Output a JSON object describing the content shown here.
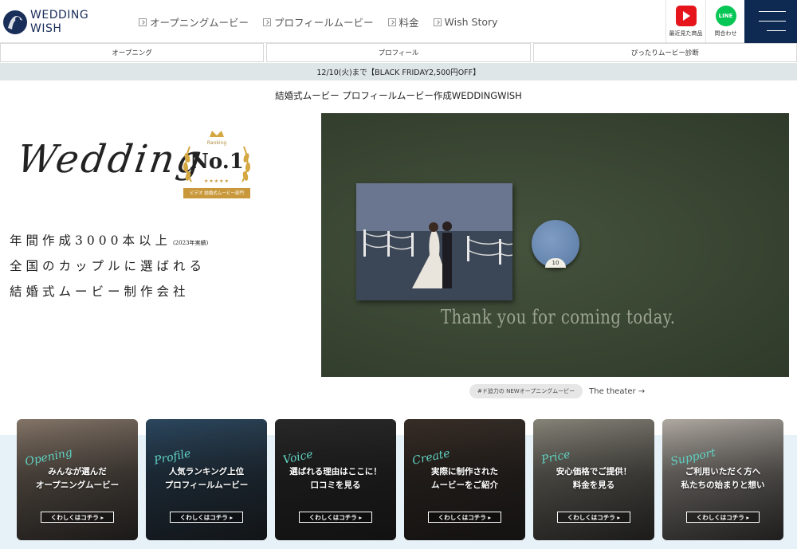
{
  "header": {
    "logo_line1": "WEDDING",
    "logo_line2": "WISH",
    "nav": [
      "オープニングムービー",
      "プロフィールムービー",
      "料金",
      "Wish Story"
    ],
    "recent_label": "最近見た商品",
    "contact_label": "問合わせ",
    "line_icon_text": "LINE"
  },
  "subtabs": [
    "オープニング",
    "プロフィール",
    "ぴったりムービー診断"
  ],
  "promo": "12/10(火)まで【BLACK FRIDAY2,500円OFF】",
  "site_title": "結婚式ムービー プロフィールムービー作成WEDDINGWISH",
  "hero": {
    "script": "Wedding",
    "badge_ranking": "Ranking",
    "badge_no1": "No.1",
    "badge_stars": "★★★★★",
    "badge_ribbon": "ビデオ 結婚式ムービー部門",
    "line1": "年間作成3000本以上",
    "line1_note": "(2023年実績)",
    "line2": "全国のカップルに選ばれる",
    "line3": "結婚式ムービー制作会社"
  },
  "video": {
    "overlay_text": "Thank you for coming today.",
    "disc_number": "10",
    "caption_tag": "#ド迫力の NEWオープニングムービー",
    "caption_link": "The theater →"
  },
  "cards": [
    {
      "script": "Opening",
      "title": "みんなが選んだ\nオープニングムービー",
      "button": "くわしくはコチラ ▸",
      "color": "#8a7a6c"
    },
    {
      "script": "Profile",
      "title": "人気ランキング上位\nプロフィールムービー",
      "button": "くわしくはコチラ ▸",
      "color": "#2d4a63"
    },
    {
      "script": "Voice",
      "title": "選ばれる理由はここに！\n口コミを見る",
      "button": "くわしくはコチラ ▸",
      "color": "#2a2a2a"
    },
    {
      "script": "Create",
      "title": "実際に制作された\nムービーをご紹介",
      "button": "くわしくはコチラ ▸",
      "color": "#3a2f28"
    },
    {
      "script": "Price",
      "title": "安心価格でご提供！\n料金を見る",
      "button": "くわしくはコチラ ▸",
      "color": "#8d8a7e"
    },
    {
      "script": "Support",
      "title": "ご利用いただく方へ\n私たちの始まりと想い",
      "button": "くわしくはコチラ ▸",
      "color": "#b9b2aa"
    }
  ]
}
